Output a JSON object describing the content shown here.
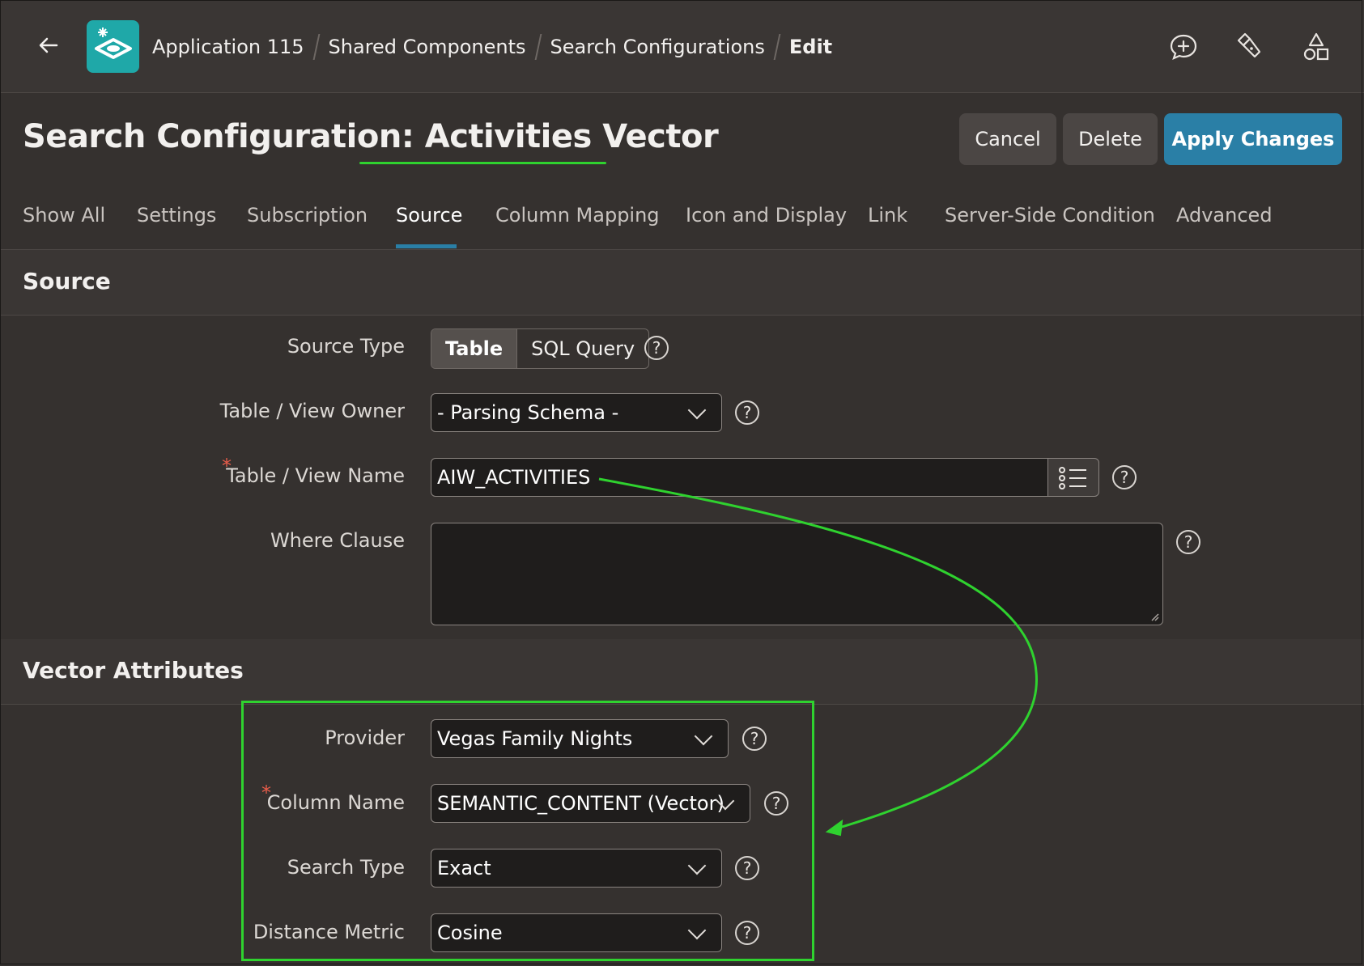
{
  "header": {
    "breadcrumbs": [
      "Application 115",
      "Shared Components",
      "Search Configurations"
    ],
    "current": "Edit"
  },
  "title": {
    "prefix": "Search Configuration:",
    "name": "Activities Vector"
  },
  "buttons": {
    "cancel": "Cancel",
    "delete": "Delete",
    "apply": "Apply Changes"
  },
  "tabs": [
    "Show All",
    "Settings",
    "Subscription",
    "Source",
    "Column Mapping",
    "Icon and Display",
    "Link",
    "Server-Side Condition",
    "Advanced"
  ],
  "active_tab": "Source",
  "source": {
    "title": "Source",
    "source_type_label": "Source Type",
    "source_type_options": [
      "Table",
      "SQL Query"
    ],
    "source_type_selected": "Table",
    "owner_label": "Table / View Owner",
    "owner_value": "- Parsing Schema -",
    "name_label": "Table / View Name",
    "name_value": "AIW_ACTIVITIES",
    "where_label": "Where Clause",
    "where_value": ""
  },
  "vector": {
    "title": "Vector Attributes",
    "provider_label": "Provider",
    "provider_value": "Vegas Family Nights",
    "column_label": "Column Name",
    "column_value": "SEMANTIC_CONTENT (Vector)",
    "search_type_label": "Search Type",
    "search_type_value": "Exact",
    "metric_label": "Distance Metric",
    "metric_value": "Cosine"
  },
  "help_glyph": "?",
  "required_glyph": "*",
  "colors": {
    "background": "#35312f",
    "primary": "#2a7fa6",
    "logo": "#1fa8a8",
    "annotation": "#2fd22f",
    "required": "#e85c4a"
  }
}
